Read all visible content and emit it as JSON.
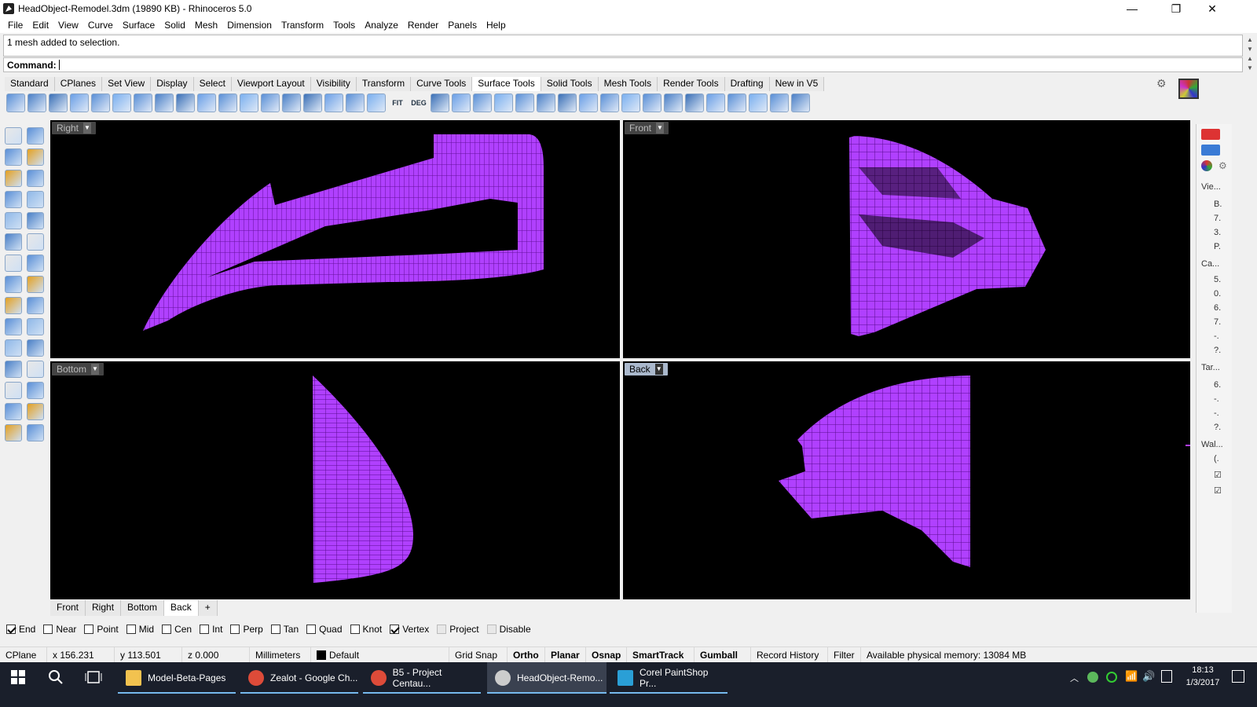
{
  "window": {
    "title": "HeadObject-Remodel.3dm (19890 KB) - Rhinoceros 5.0",
    "minimize": "—",
    "maximize": "❐",
    "close": "✕"
  },
  "menu": [
    "File",
    "Edit",
    "View",
    "Curve",
    "Surface",
    "Solid",
    "Mesh",
    "Dimension",
    "Transform",
    "Tools",
    "Analyze",
    "Render",
    "Panels",
    "Help"
  ],
  "command": {
    "history": "1 mesh added to selection.",
    "prompt": "Command:"
  },
  "toolbar_tabs": [
    "Standard",
    "CPlanes",
    "Set View",
    "Display",
    "Select",
    "Viewport Layout",
    "Visibility",
    "Transform",
    "Curve Tools",
    "Surface Tools",
    "Solid Tools",
    "Mesh Tools",
    "Render Tools",
    "Drafting",
    "New in V5"
  ],
  "active_toolbar_tab": "Surface Tools",
  "tool_labels": {
    "fit": "FIT",
    "deg": "DEG"
  },
  "viewports": {
    "right": "Right",
    "front": "Front",
    "bottom": "Bottom",
    "back": "Back",
    "active": "Back"
  },
  "mesh_color": "#b040ff",
  "viewport_tabs": [
    "Front",
    "Right",
    "Bottom",
    "Back",
    "+"
  ],
  "active_viewport_tab": "Back",
  "right_panel": [
    "Vie...",
    "B.",
    "7.",
    "3.",
    "P.",
    "Ca...",
    "5.",
    "0.",
    "6.",
    "7.",
    "-.",
    "?.",
    "Tar...",
    "6.",
    "-.",
    "-.",
    "?.",
    "Wal...",
    "(.",
    "☑",
    "☑"
  ],
  "osnaps": [
    {
      "label": "End",
      "checked": true
    },
    {
      "label": "Near",
      "checked": false
    },
    {
      "label": "Point",
      "checked": false
    },
    {
      "label": "Mid",
      "checked": false
    },
    {
      "label": "Cen",
      "checked": false
    },
    {
      "label": "Int",
      "checked": false
    },
    {
      "label": "Perp",
      "checked": false
    },
    {
      "label": "Tan",
      "checked": false
    },
    {
      "label": "Quad",
      "checked": false
    },
    {
      "label": "Knot",
      "checked": false
    },
    {
      "label": "Vertex",
      "checked": true
    },
    {
      "label": "Project",
      "checked": false
    },
    {
      "label": "Disable",
      "checked": false
    }
  ],
  "status": {
    "cplane": "CPlane",
    "x": "x 156.231",
    "y": "y 113.501",
    "z": "z 0.000",
    "units": "Millimeters",
    "layer": "Default",
    "grid_snap": "Grid Snap",
    "ortho": "Ortho",
    "planar": "Planar",
    "osnap": "Osnap",
    "smarttrack": "SmartTrack",
    "gumball": "Gumball",
    "record_history": "Record History",
    "filter": "Filter",
    "memory": "Available physical memory: 13084 MB"
  },
  "taskbar": {
    "apps": [
      {
        "label": "Model-Beta-Pages",
        "icon": "folder-icon",
        "color": "#f2c24f"
      },
      {
        "label": "Zealot - Google Ch...",
        "icon": "chrome-icon",
        "color": "#dd4b39"
      },
      {
        "label": "B5 - Project Centau...",
        "icon": "chrome-icon",
        "color": "#dd4b39"
      },
      {
        "label": "HeadObject-Remo...",
        "icon": "rhino-icon",
        "color": "#cccccc"
      },
      {
        "label": "Corel PaintShop Pr...",
        "icon": "paintshop-icon",
        "color": "#2a9fd6"
      }
    ],
    "time": "18:13",
    "date": "1/3/2017"
  }
}
